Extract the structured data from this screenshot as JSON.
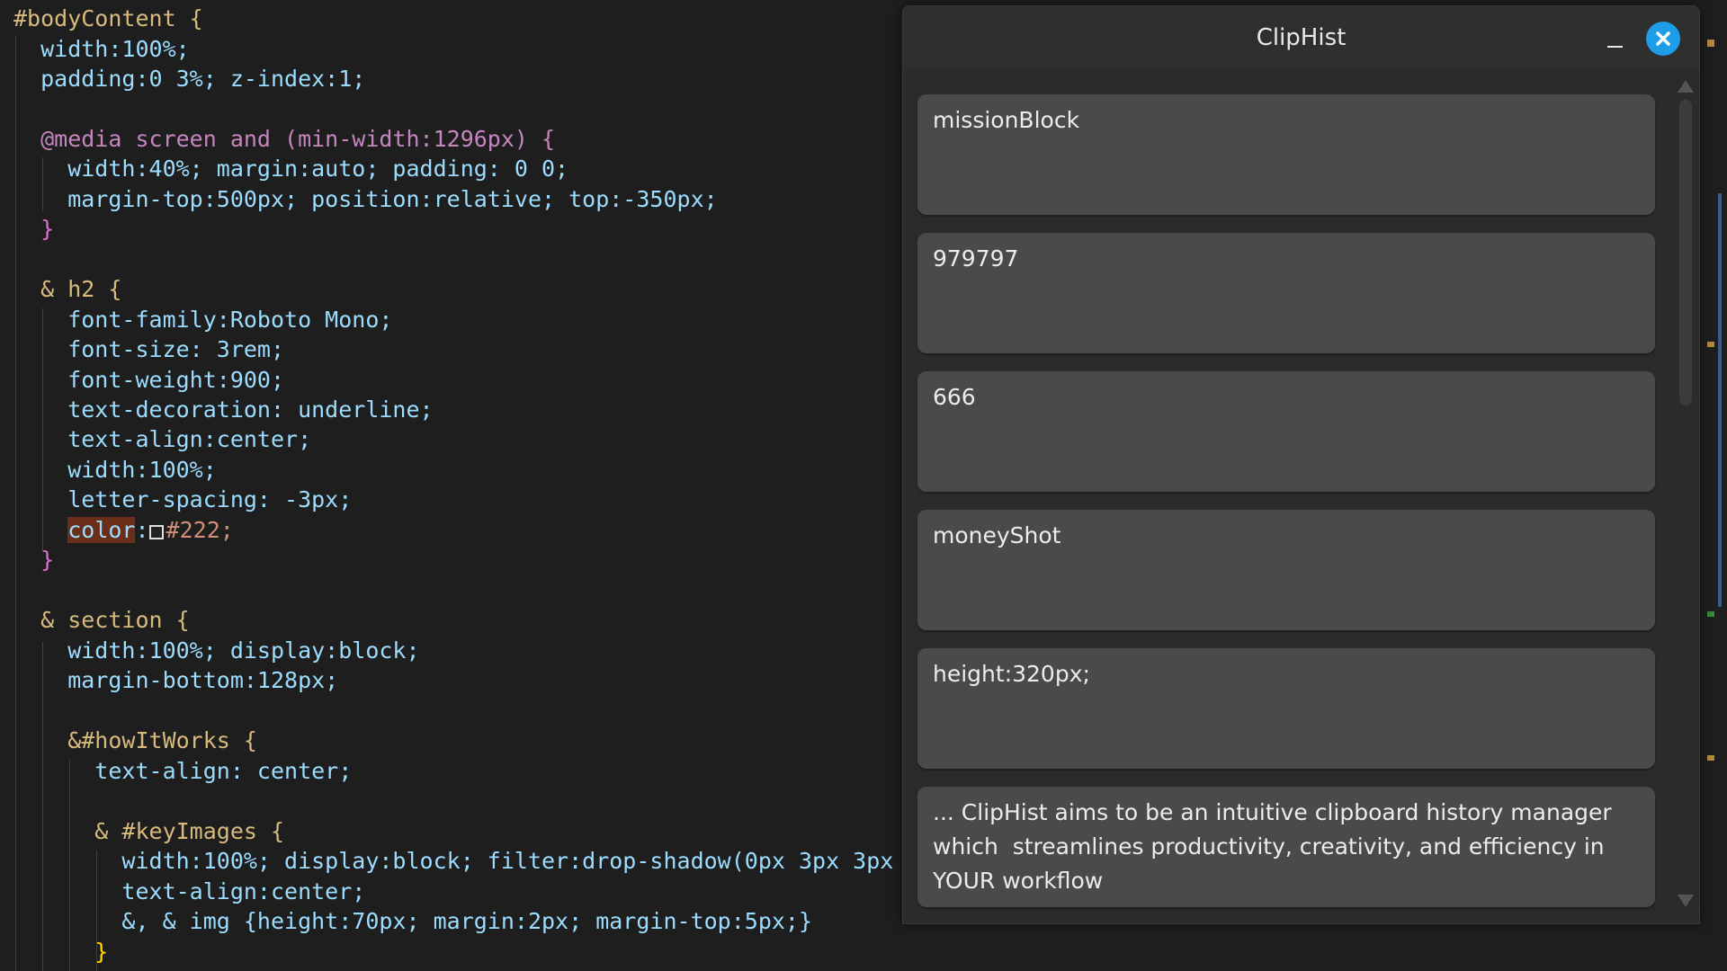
{
  "editor": {
    "lines": [
      "#bodyContent {",
      "  width:100%;",
      "  padding:0 3%; z-index:1;",
      "",
      "  @media screen and (min-width:1296px) {",
      "    width:40%; margin:auto; padding: 0 0;",
      "    margin-top:500px; position:relative; top:-350px;",
      "  }",
      "",
      "  & h2 {",
      "    font-family:Roboto Mono;",
      "    font-size: 3rem;",
      "    font-weight:900;",
      "    text-decoration: underline;",
      "    text-align:center;",
      "    width:100%;",
      "    letter-spacing: -3px;",
      "    color: #222;",
      "  }",
      "",
      "  & section {",
      "    width:100%; display:block;",
      "    margin-bottom:128px;",
      "",
      "    &#howItWorks {",
      "      text-align: center;",
      "",
      "      & #keyImages {",
      "        width:100%; display:block; filter:drop-shadow(0px 3px 3px",
      "        text-align:center;",
      "        &, & img {height:70px; margin:2px; margin-top:5px;}",
      "      }"
    ],
    "swatch_color": "#222222"
  },
  "window": {
    "title": "ClipHist",
    "minimize_label": "minimize",
    "close_label": "close"
  },
  "clips": [
    {
      "text": "missionBlock"
    },
    {
      "text": "979797"
    },
    {
      "text": "666"
    },
    {
      "text": "moneyShot"
    },
    {
      "text": "height:320px;"
    },
    {
      "text": "... ClipHist aims to be an intuitive clipboard history manager which  streamlines productivity, creativity, and efficiency in YOUR workflow"
    }
  ],
  "colors": {
    "window_bg": "#2b2b2b",
    "card_bg": "#4a4a4a",
    "close_accent": "#1e9de8",
    "editor_bg": "#1e1e1e"
  }
}
